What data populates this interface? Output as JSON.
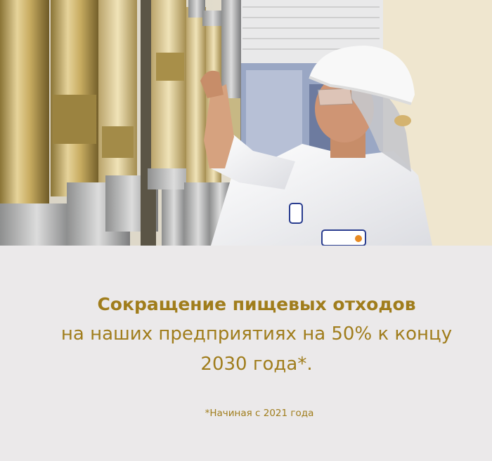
{
  "headline": {
    "bold_line": "Сокращение пищевых отходов",
    "regular_text": "на наших предприятиях на 50% к концу 2030 года*."
  },
  "footnote": "*Начиная с 2021 года",
  "colors": {
    "accent": "#a07d1c",
    "panel_background": "#ebe9ea"
  },
  "photo": {
    "subject": "worker-in-hard-hat-and-lab-coat-at-factory-flow-meters"
  }
}
